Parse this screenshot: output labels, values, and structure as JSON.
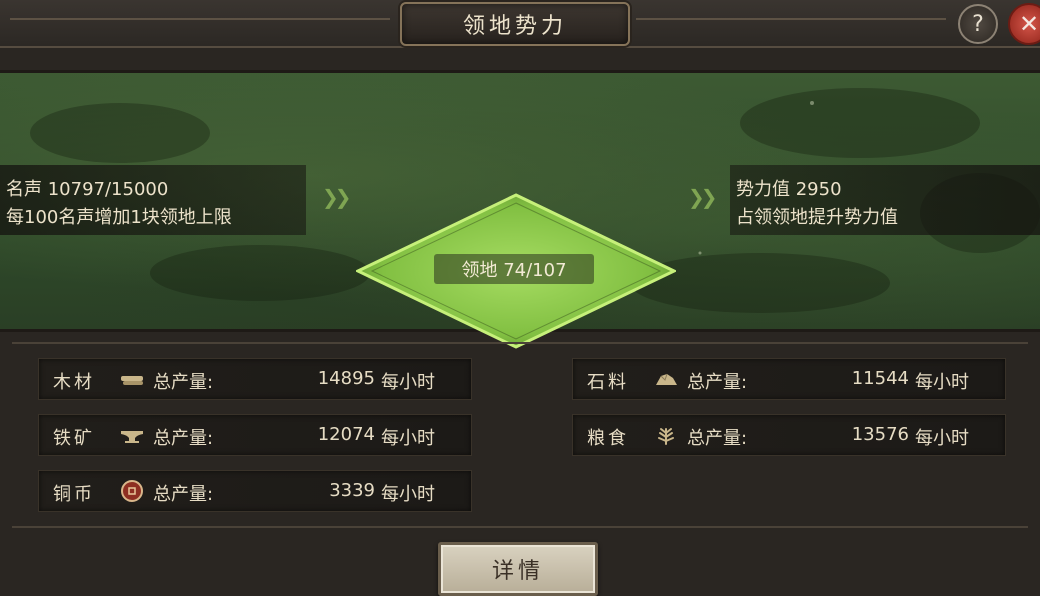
{
  "window": {
    "title": "领地势力",
    "help_label": "?",
    "close_label": "✕"
  },
  "territory": {
    "fame_line": "名声 10797/15000",
    "fame_hint": "每100名声增加1块领地上限",
    "territory_line": "领地 74/107",
    "power_line": "势力值 2950",
    "power_hint": "占领领地提升势力值",
    "fame_current": 10797,
    "fame_max": 15000,
    "territory_current": 74,
    "territory_max": 107,
    "power_value": 2950
  },
  "resources": [
    {
      "name": "木材",
      "icon": "wood-icon",
      "label": "总产量:",
      "value": "14895",
      "unit": "每小时"
    },
    {
      "name": "石料",
      "icon": "stone-icon",
      "label": "总产量:",
      "value": "11544",
      "unit": "每小时"
    },
    {
      "name": "铁矿",
      "icon": "iron-anvil-icon",
      "label": "总产量:",
      "value": "12074",
      "unit": "每小时"
    },
    {
      "name": "粮食",
      "icon": "grain-icon",
      "label": "总产量:",
      "value": "13576",
      "unit": "每小时"
    },
    {
      "name": "铜币",
      "icon": "copper-coin-icon",
      "label": "总产量:",
      "value": "3339",
      "unit": "每小时"
    }
  ],
  "footer": {
    "detail_label": "详情"
  },
  "colors": {
    "accent_green": "#8ed04c",
    "panel_dark": "#211e1a",
    "close_red": "#c0392b"
  }
}
